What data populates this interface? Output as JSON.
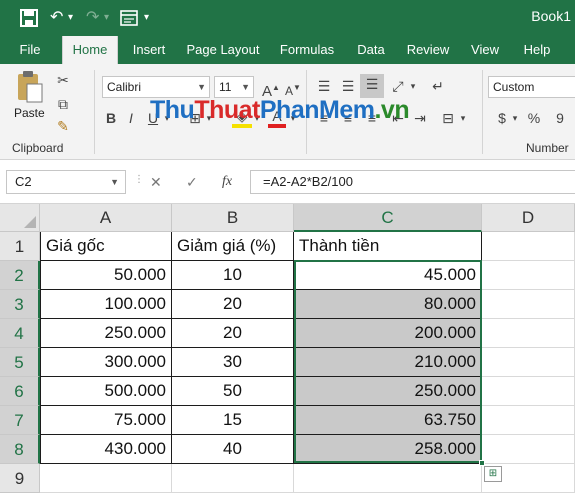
{
  "title_bar": {
    "title": "Book1",
    "save_icon": "save-icon",
    "undo_icon": "undo-icon",
    "redo_icon": "redo-icon",
    "form_icon": "form-icon",
    "undo_glyph": "↶",
    "redo_glyph": "↷",
    "dropdown_glyph": "▾"
  },
  "tabs": [
    "File",
    "Home",
    "Insert",
    "Page Layout",
    "Formulas",
    "Data",
    "Review",
    "View",
    "Help"
  ],
  "active_tab": "Home",
  "ribbon": {
    "clipboard": {
      "paste_label": "Paste",
      "group_label": "Clipboard"
    },
    "font": {
      "name": "Calibri",
      "size": "11",
      "bold": "B",
      "italic": "I",
      "underline": "U"
    },
    "number": {
      "format": "Custom",
      "currency": "$",
      "percent": "%",
      "comma": "9",
      "group_label": "Number"
    }
  },
  "watermark": {
    "part1": "Thu",
    "part2": "Thuat",
    "part3": "PhanMem",
    "part4": ".vn"
  },
  "formula_bar": {
    "name_box": "C2",
    "cancel": "✕",
    "enter": "✓",
    "fx": "fx",
    "formula": "=A2-A2*B2/100"
  },
  "sheet": {
    "columns": [
      "A",
      "B",
      "C",
      "D"
    ],
    "rows": [
      "1",
      "2",
      "3",
      "4",
      "5",
      "6",
      "7",
      "8",
      "9"
    ],
    "headers": [
      "Giá gốc",
      "Giảm giá (%)",
      "Thành tiền"
    ],
    "data": [
      [
        "50.000",
        "10",
        "45.000"
      ],
      [
        "100.000",
        "20",
        "80.000"
      ],
      [
        "250.000",
        "20",
        "200.000"
      ],
      [
        "300.000",
        "30",
        "210.000"
      ],
      [
        "500.000",
        "50",
        "250.000"
      ],
      [
        "75.000",
        "15",
        "63.750"
      ],
      [
        "430.000",
        "40",
        "258.000"
      ]
    ],
    "selected_column": "C",
    "selection": "C2:C8"
  },
  "colors": {
    "accent": "#217346",
    "selection_fill": "#c9c9c9"
  }
}
